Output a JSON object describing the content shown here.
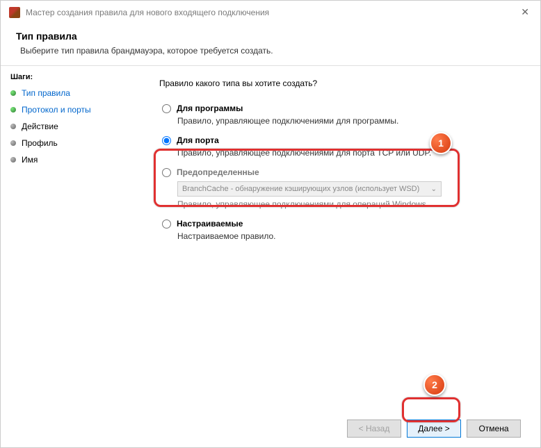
{
  "titlebar": {
    "title": "Мастер создания правила для нового входящего подключения"
  },
  "header": {
    "title": "Тип правила",
    "subtitle": "Выберите тип правила брандмауэра, которое требуется создать."
  },
  "sidebar": {
    "steps_label": "Шаги:",
    "items": [
      {
        "label": "Тип правила"
      },
      {
        "label": "Протокол и порты"
      },
      {
        "label": "Действие"
      },
      {
        "label": "Профиль"
      },
      {
        "label": "Имя"
      }
    ]
  },
  "content": {
    "prompt": "Правило какого типа вы хотите создать?",
    "options": [
      {
        "title": "Для программы",
        "desc": "Правило, управляющее подключениями для программы."
      },
      {
        "title": "Для порта",
        "desc": "Правило, управляющее подключениями для порта TCP или UDP."
      },
      {
        "title": "Предопределенные",
        "desc": "Правило, управляющее подключениями для операций Windows.",
        "dropdown": "BranchCache - обнаружение кэширующих узлов (использует WSD)"
      },
      {
        "title": "Настраиваемые",
        "desc": "Настраиваемое правило."
      }
    ]
  },
  "footer": {
    "back": "< Назад",
    "next": "Далее >",
    "cancel": "Отмена"
  },
  "badges": {
    "one": "1",
    "two": "2"
  }
}
